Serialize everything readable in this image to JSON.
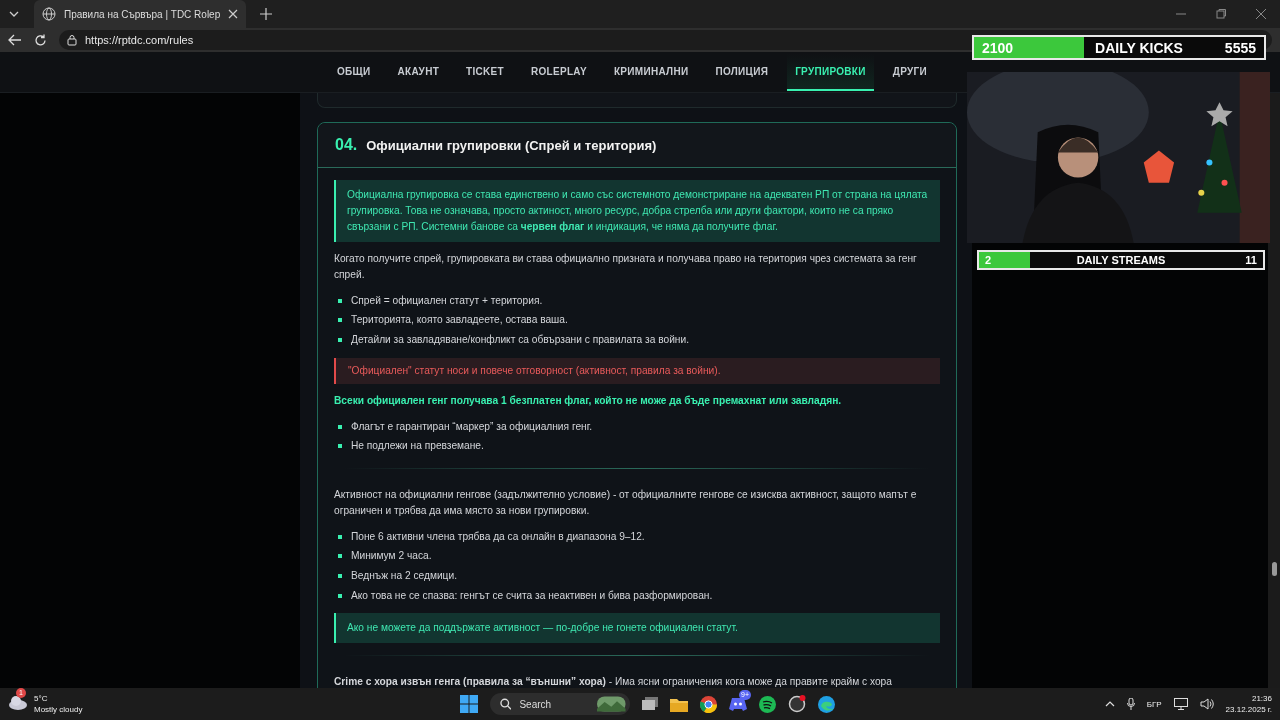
{
  "browser": {
    "tab_title": "Правила на Сървъра | TDC Rolep",
    "url": "https://rptdc.com/rules"
  },
  "nav": [
    {
      "label": "ОБЩИ",
      "selected": false
    },
    {
      "label": "АКАУНТ",
      "selected": false
    },
    {
      "label": "TICKET",
      "selected": false
    },
    {
      "label": "ROLEPLAY",
      "selected": false
    },
    {
      "label": "КРИМИНАЛНИ",
      "selected": false
    },
    {
      "label": "ПОЛИЦИЯ",
      "selected": false
    },
    {
      "label": "ГРУПИРОВКИ",
      "selected": true
    },
    {
      "label": "ДРУГИ",
      "selected": false
    }
  ],
  "overlay": {
    "goals": [
      {
        "current": "2100",
        "label": "DAILY KICKS",
        "target": "5555",
        "level": 0.38
      },
      {
        "current": "2",
        "label": "DAILY STREAMS",
        "target": "11",
        "level": 0.18
      }
    ]
  },
  "section": {
    "number": "04.",
    "title": "Официални групировки (Спрей и територия)",
    "blocks": [
      {
        "kind": "note",
        "text": "Официална групировка се става единствено и само със системното демонстриране на адекватен РП от страна на цялата групировка. Това не означава, просто актиност, много ресурс, добра стрелба или други фактори, които не са пряко свързани с РП. Системни банове са **червен флаг** и индикация, че няма да получите флаг."
      },
      {
        "kind": "paragraph",
        "text": "Когато получите спрей, групировката ви става официално призната и получава право на територия чрез системата за генг спрей."
      },
      {
        "kind": "list",
        "items": [
          "Спрей = официален статут + територия.",
          "Територията, която завладеете, остава ваша.",
          "Детайли за завладяване/конфликт са обвързани с правилата за войни."
        ]
      },
      {
        "kind": "warning",
        "text": "\"Официален\" статут носи и повече отговорност (активност, правила за войни)."
      },
      {
        "kind": "lead",
        "text": "Всеки официален генг получава 1 безплатен флаг, който не може да бъде премахнат или завладян."
      },
      {
        "kind": "list",
        "items": [
          "Флагът е гарантиран “маркер” за официалния генг.",
          "Не подлежи на превземане."
        ]
      },
      {
        "kind": "divider"
      },
      {
        "kind": "paragraph",
        "text": "Активност на официални генгове (задължително условие) - от официалните генгове се изисква активност, защото мапът е ограничен и трябва да има място за нови групировки."
      },
      {
        "kind": "list",
        "items": [
          "Поне 6 активни члена трябва да са онлайн в диапазона 9–12.",
          "Минимум 2 часа.",
          "Веднъж на 2 седмици.",
          "Ако това не се спазва: генгът се счита за неактивен и бива разформирован."
        ]
      },
      {
        "kind": "note",
        "text": "Ако не можете да поддържате активност — по-добре не гонете официален статут."
      },
      {
        "kind": "divider"
      },
      {
        "kind": "paragraph",
        "text": "**Crime с хора извън генга (правила за “външни” хора)** - Има ясни ограничения кога може да правите крайм с хора"
      }
    ]
  },
  "taskbar": {
    "weather_badge": "1",
    "temperature": "5°C",
    "weather": "Mostly cloudy",
    "search_placeholder": "Search",
    "chat_badge": "9+",
    "language": "БГР",
    "time": "21:36",
    "date": "23.12.2025 г."
  }
}
